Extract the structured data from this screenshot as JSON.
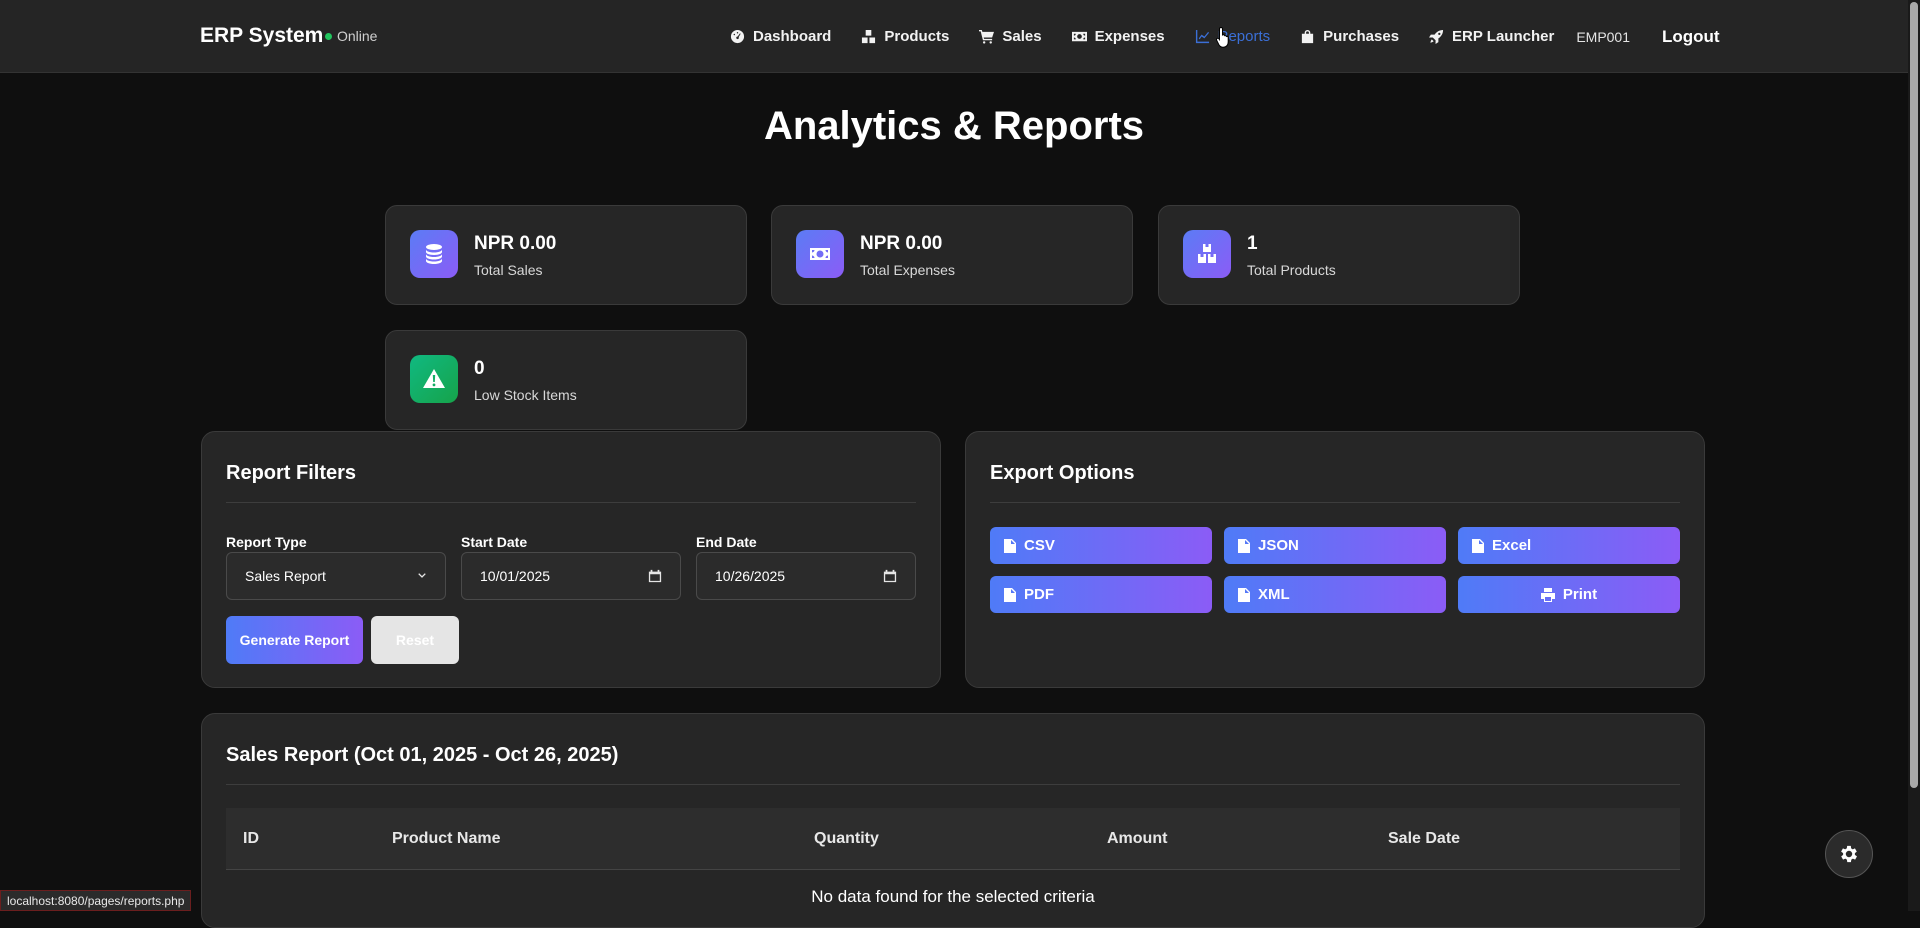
{
  "header": {
    "brand": "ERP System",
    "status": "Online",
    "nav": [
      {
        "label": "Dashboard",
        "icon": "gauge-icon"
      },
      {
        "label": "Products",
        "icon": "boxes-icon"
      },
      {
        "label": "Sales",
        "icon": "cart-icon"
      },
      {
        "label": "Expenses",
        "icon": "money-bill-icon"
      },
      {
        "label": "Reports",
        "icon": "chart-line-icon",
        "active": true
      },
      {
        "label": "Purchases",
        "icon": "shopping-bag-icon"
      },
      {
        "label": "ERP Launcher",
        "icon": "rocket-icon"
      }
    ],
    "employee_id": "EMP001",
    "logout": "Logout"
  },
  "page": {
    "title": "Analytics & Reports"
  },
  "stats": [
    {
      "value": "NPR 0.00",
      "label": "Total Sales",
      "icon": "coins-icon"
    },
    {
      "value": "NPR 0.00",
      "label": "Total Expenses",
      "icon": "money-bill-icon"
    },
    {
      "value": "1",
      "label": "Total Products",
      "icon": "boxes-icon"
    },
    {
      "value": "0",
      "label": "Low Stock Items",
      "icon": "warning-icon"
    }
  ],
  "filters": {
    "title": "Report Filters",
    "report_type_label": "Report Type",
    "report_type_value": "Sales Report",
    "start_date_label": "Start Date",
    "start_date_value": "10/01/2025",
    "end_date_label": "End Date",
    "end_date_value": "10/26/2025",
    "generate_label": "Generate Report",
    "reset_label": "Reset"
  },
  "export": {
    "title": "Export Options",
    "buttons": [
      "CSV",
      "JSON",
      "Excel",
      "PDF",
      "XML",
      "Print"
    ]
  },
  "report": {
    "title": "Sales Report (Oct 01, 2025 - Oct 26, 2025)",
    "columns": [
      "ID",
      "Product Name",
      "Quantity",
      "Amount",
      "Sale Date"
    ],
    "empty_message": "No data found for the selected criteria"
  },
  "status_bar": {
    "url": "localhost:8080/pages/reports.php"
  },
  "colors": {
    "accent_start": "#4f7bf7",
    "accent_end": "#8b5cf6",
    "online": "#22c55e",
    "warning": "#10b981"
  }
}
